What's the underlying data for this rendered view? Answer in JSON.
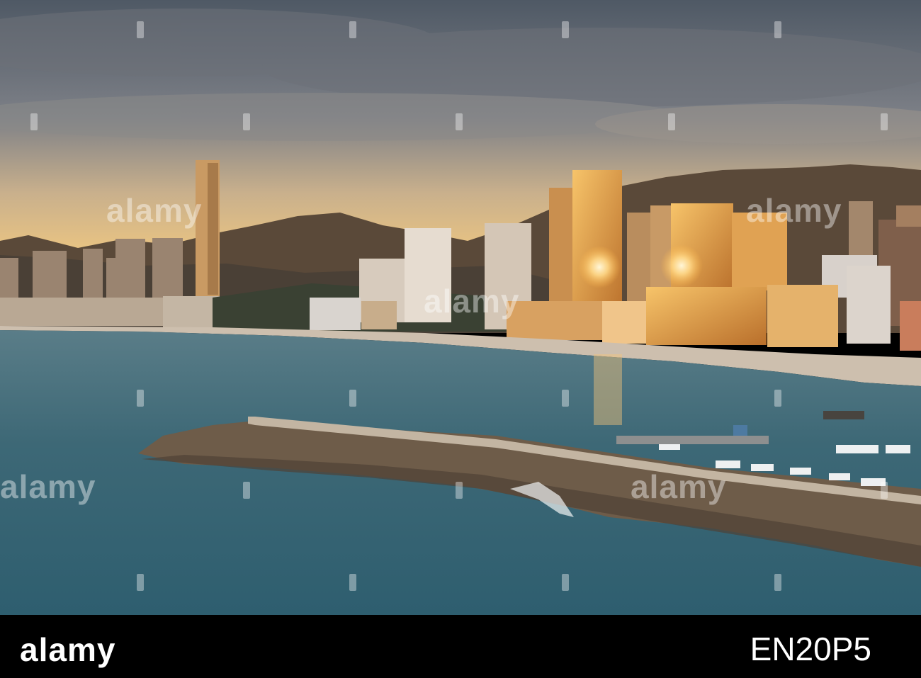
{
  "watermark": {
    "text": "alamy",
    "color": "#ffffff"
  },
  "footer": {
    "logo": "alamy",
    "image_id": "EN20P5",
    "background": "#000000"
  },
  "palette": {
    "sky_top": "#5f6672",
    "sky_glow": "#f0c172",
    "mountains": "#5d4a3a",
    "sea": "#3f6a79",
    "golden_facade": "#e9a245",
    "breakwater": "#6b5a48"
  }
}
